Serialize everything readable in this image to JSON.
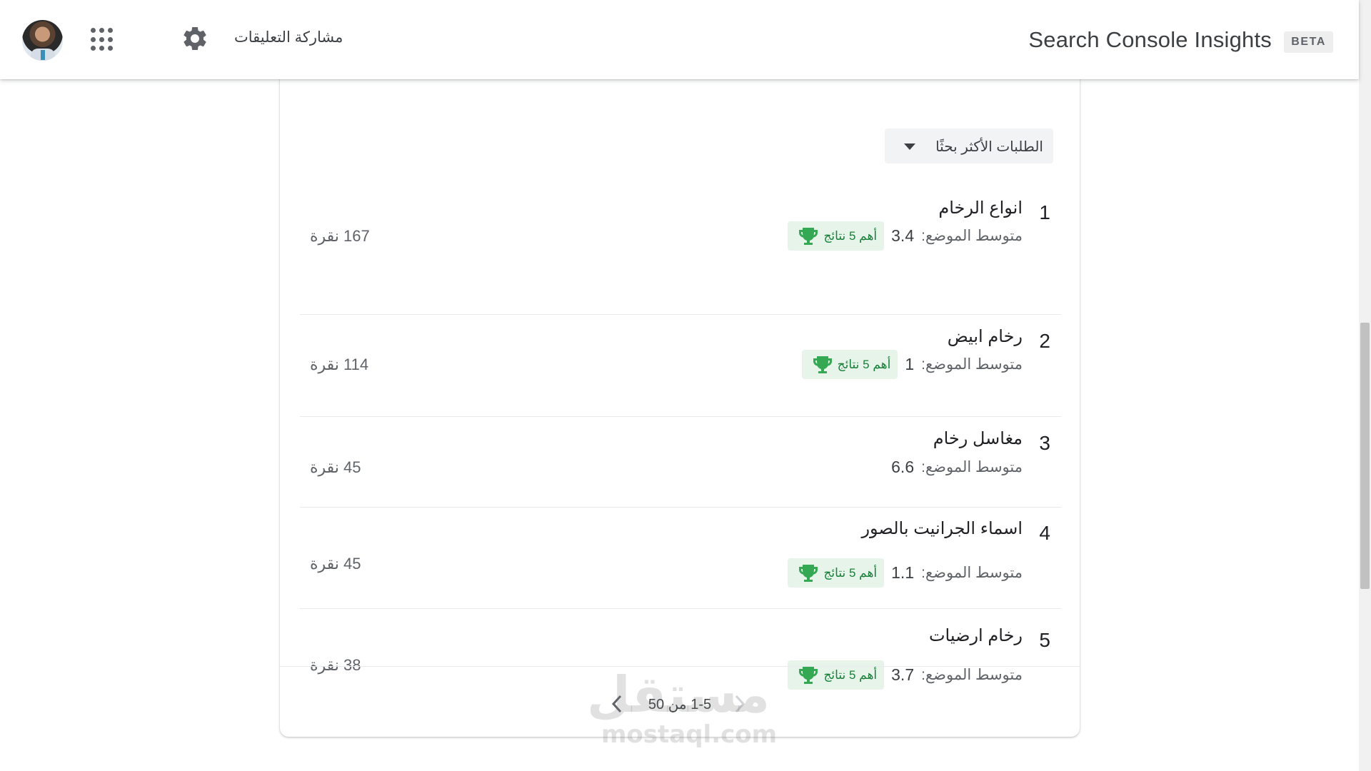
{
  "header": {
    "title": "Search Console Insights",
    "beta": "BETA",
    "feedback_label": "مشاركة التعليقات",
    "icons": [
      "avatar",
      "apps-grid-icon",
      "gear-icon"
    ]
  },
  "queries": {
    "dropdown_label": "الطلبات الأكثر بحثًا",
    "position_label": "متوسط الموضع:",
    "badge_label": "أهم 5 نتائج",
    "rows": [
      {
        "rank": "1",
        "query": "انواع الرخام",
        "position": "3.4",
        "clicks": "167 نقرة",
        "top5": true
      },
      {
        "rank": "2",
        "query": "رخام ابيض",
        "position": "1",
        "clicks": "114 نقرة",
        "top5": true
      },
      {
        "rank": "3",
        "query": "مغاسل رخام",
        "position": "6.6",
        "clicks": "45 نقرة",
        "top5": false
      },
      {
        "rank": "4",
        "query": "اسماء الجرانيت بالصور",
        "position": "1.1",
        "clicks": "45 نقرة",
        "top5": true
      },
      {
        "rank": "5",
        "query": "رخام ارضيات",
        "position": "3.7",
        "clicks": "38 نقرة",
        "top5": true
      }
    ],
    "pagination": "1-5 من 50"
  },
  "watermark": {
    "arabic": "مستقل",
    "latin": "mostaql.com"
  },
  "colors": {
    "badge_bg": "#e6f4ea",
    "badge_fg": "#188038",
    "text": "#3c4043"
  }
}
